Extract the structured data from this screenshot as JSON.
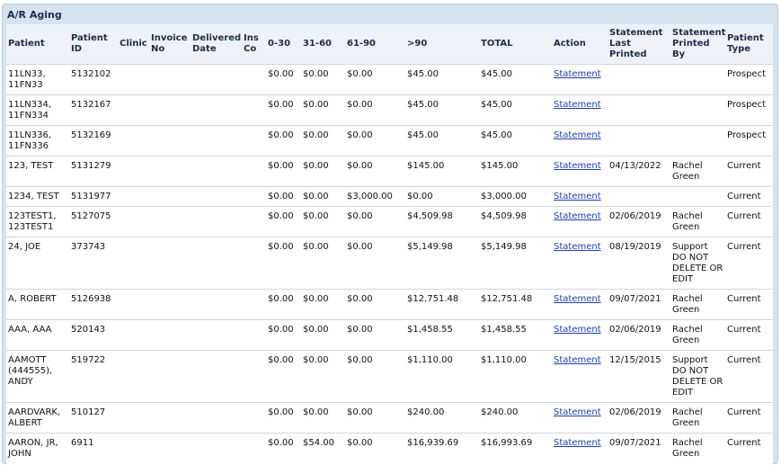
{
  "panel": {
    "title": "A/R Aging"
  },
  "columns": {
    "patient": "Patient",
    "patient_id": "Patient ID",
    "clinic": "Clinic",
    "invoice_no": "Invoice No",
    "delivered_date": "Delivered Date",
    "ins_co": "Ins Co",
    "b0_30": "0-30",
    "b31_60": "31-60",
    "b61_90": "61-90",
    "b90": ">90",
    "total": "TOTAL",
    "action": "Action",
    "stmt_last": "Statement Last Printed",
    "stmt_by": "Statement Printed By",
    "patient_type": "Patient Type"
  },
  "rows": [
    {
      "patient": "11LN33, 11FN33",
      "id": "5132102",
      "b0": "$0.00",
      "b31": "$0.00",
      "b61": "$0.00",
      "b90": "$45.00",
      "total": "$45.00",
      "action": "Statement",
      "last": "",
      "by": "",
      "type": "Prospect"
    },
    {
      "patient": "11LN334, 11FN334",
      "id": "5132167",
      "b0": "$0.00",
      "b31": "$0.00",
      "b61": "$0.00",
      "b90": "$45.00",
      "total": "$45.00",
      "action": "Statement",
      "last": "",
      "by": "",
      "type": "Prospect"
    },
    {
      "patient": "11LN336, 11FN336",
      "id": "5132169",
      "b0": "$0.00",
      "b31": "$0.00",
      "b61": "$0.00",
      "b90": "$45.00",
      "total": "$45.00",
      "action": "Statement",
      "last": "",
      "by": "",
      "type": "Prospect"
    },
    {
      "patient": "123, TEST",
      "id": "5131279",
      "b0": "$0.00",
      "b31": "$0.00",
      "b61": "$0.00",
      "b90": "$145.00",
      "total": "$145.00",
      "action": "Statement",
      "last": "04/13/2022",
      "by": "Rachel Green",
      "type": "Current"
    },
    {
      "patient": "1234, TEST",
      "id": "5131977",
      "b0": "$0.00",
      "b31": "$0.00",
      "b61": "$3,000.00",
      "b90": "$0.00",
      "total": "$3,000.00",
      "action": "Statement",
      "last": "",
      "by": "",
      "type": "Current"
    },
    {
      "patient": "123TEST1, 123TEST1",
      "id": "5127075",
      "b0": "$0.00",
      "b31": "$0.00",
      "b61": "$0.00",
      "b90": "$4,509.98",
      "total": "$4,509.98",
      "action": "Statement",
      "last": "02/06/2019",
      "by": "Rachel Green",
      "type": "Current"
    },
    {
      "patient": "24, JOE",
      "id": "373743",
      "b0": "$0.00",
      "b31": "$0.00",
      "b61": "$0.00",
      "b90": "$5,149.98",
      "total": "$5,149.98",
      "action": "Statement",
      "last": "08/19/2019",
      "by": "Support DO NOT DELETE OR EDIT",
      "type": "Current"
    },
    {
      "patient": "A, ROBERT",
      "id": "5126938",
      "b0": "$0.00",
      "b31": "$0.00",
      "b61": "$0.00",
      "b90": "$12,751.48",
      "total": "$12,751.48",
      "action": "Statement",
      "last": "09/07/2021",
      "by": "Rachel Green",
      "type": "Current"
    },
    {
      "patient": "AAA, AAA",
      "id": "520143",
      "b0": "$0.00",
      "b31": "$0.00",
      "b61": "$0.00",
      "b90": "$1,458.55",
      "total": "$1,458.55",
      "action": "Statement",
      "last": "02/06/2019",
      "by": "Rachel Green",
      "type": "Current"
    },
    {
      "patient": "AAMOTT (444555), ANDY",
      "id": "519722",
      "b0": "$0.00",
      "b31": "$0.00",
      "b61": "$0.00",
      "b90": "$1,110.00",
      "total": "$1,110.00",
      "action": "Statement",
      "last": "12/15/2015",
      "by": "Support DO NOT DELETE OR EDIT",
      "type": "Current"
    },
    {
      "patient": "AARDVARK, ALBERT",
      "id": "510127",
      "b0": "$0.00",
      "b31": "$0.00",
      "b61": "$0.00",
      "b90": "$240.00",
      "total": "$240.00",
      "action": "Statement",
      "last": "02/06/2019",
      "by": "Rachel Green",
      "type": "Current"
    },
    {
      "patient": "AARON, JR, JOHN",
      "id": "6911",
      "b0": "$0.00",
      "b31": "$54.00",
      "b61": "$0.00",
      "b90": "$16,939.69",
      "total": "$16,993.69",
      "action": "Statement",
      "last": "09/07/2021",
      "by": "Rachel Green",
      "type": "Current"
    }
  ]
}
